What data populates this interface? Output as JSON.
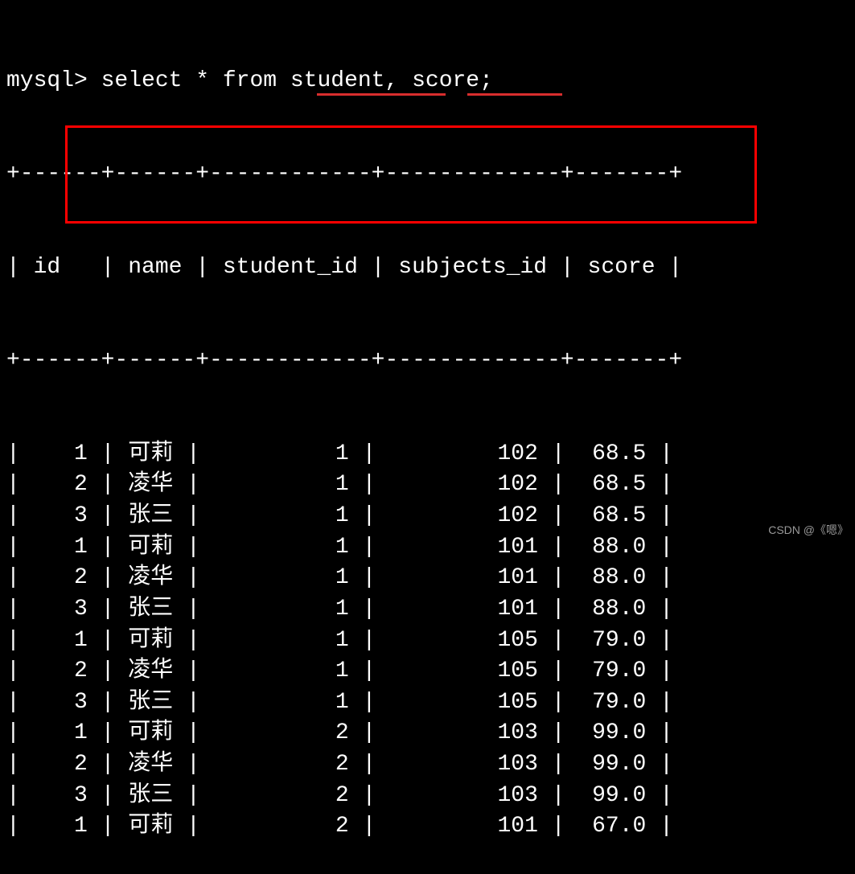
{
  "prompt": "mysql> ",
  "query": "select * from student, score;",
  "headers": {
    "id": "id",
    "name": "name",
    "student_id": "student_id",
    "subjects_id": "subjects_id",
    "score": "score"
  },
  "border_top": "+------+------+------------+-------------+-------+",
  "header_row": "| id   | name | student_id | subjects_id | score |",
  "border_mid": "+------+------+------------+-------------+-------+",
  "rows": [
    {
      "id": "1",
      "name": "可莉",
      "student_id": "1",
      "subjects_id": "102",
      "score": "68.5"
    },
    {
      "id": "2",
      "name": "凌华",
      "student_id": "1",
      "subjects_id": "102",
      "score": "68.5"
    },
    {
      "id": "3",
      "name": "张三",
      "student_id": "1",
      "subjects_id": "102",
      "score": "68.5"
    },
    {
      "id": "1",
      "name": "可莉",
      "student_id": "1",
      "subjects_id": "101",
      "score": "88.0"
    },
    {
      "id": "2",
      "name": "凌华",
      "student_id": "1",
      "subjects_id": "101",
      "score": "88.0"
    },
    {
      "id": "3",
      "name": "张三",
      "student_id": "1",
      "subjects_id": "101",
      "score": "88.0"
    },
    {
      "id": "1",
      "name": "可莉",
      "student_id": "1",
      "subjects_id": "105",
      "score": "79.0"
    },
    {
      "id": "2",
      "name": "凌华",
      "student_id": "1",
      "subjects_id": "105",
      "score": "79.0"
    },
    {
      "id": "3",
      "name": "张三",
      "student_id": "1",
      "subjects_id": "105",
      "score": "79.0"
    },
    {
      "id": "1",
      "name": "可莉",
      "student_id": "2",
      "subjects_id": "103",
      "score": "99.0"
    },
    {
      "id": "2",
      "name": "凌华",
      "student_id": "2",
      "subjects_id": "103",
      "score": "99.0"
    },
    {
      "id": "3",
      "name": "张三",
      "student_id": "2",
      "subjects_id": "103",
      "score": "99.0"
    },
    {
      "id": "1",
      "name": "可莉",
      "student_id": "2",
      "subjects_id": "101",
      "score": "67.0"
    }
  ],
  "watermark": "CSDN @《嗯》",
  "chart_data": {
    "type": "table",
    "title": "MySQL query result: select * from student, score",
    "columns": [
      "id",
      "name",
      "student_id",
      "subjects_id",
      "score"
    ],
    "data": [
      [
        1,
        "可莉",
        1,
        102,
        68.5
      ],
      [
        2,
        "凌华",
        1,
        102,
        68.5
      ],
      [
        3,
        "张三",
        1,
        102,
        68.5
      ],
      [
        1,
        "可莉",
        1,
        101,
        88.0
      ],
      [
        2,
        "凌华",
        1,
        101,
        88.0
      ],
      [
        3,
        "张三",
        1,
        101,
        88.0
      ],
      [
        1,
        "可莉",
        1,
        105,
        79.0
      ],
      [
        2,
        "凌华",
        1,
        105,
        79.0
      ],
      [
        3,
        "张三",
        1,
        105,
        79.0
      ],
      [
        1,
        "可莉",
        2,
        103,
        99.0
      ],
      [
        2,
        "凌华",
        2,
        103,
        99.0
      ],
      [
        3,
        "张三",
        2,
        103,
        99.0
      ],
      [
        1,
        "可莉",
        2,
        101,
        67.0
      ]
    ],
    "highlighted_rows": [
      0,
      1,
      2
    ]
  }
}
